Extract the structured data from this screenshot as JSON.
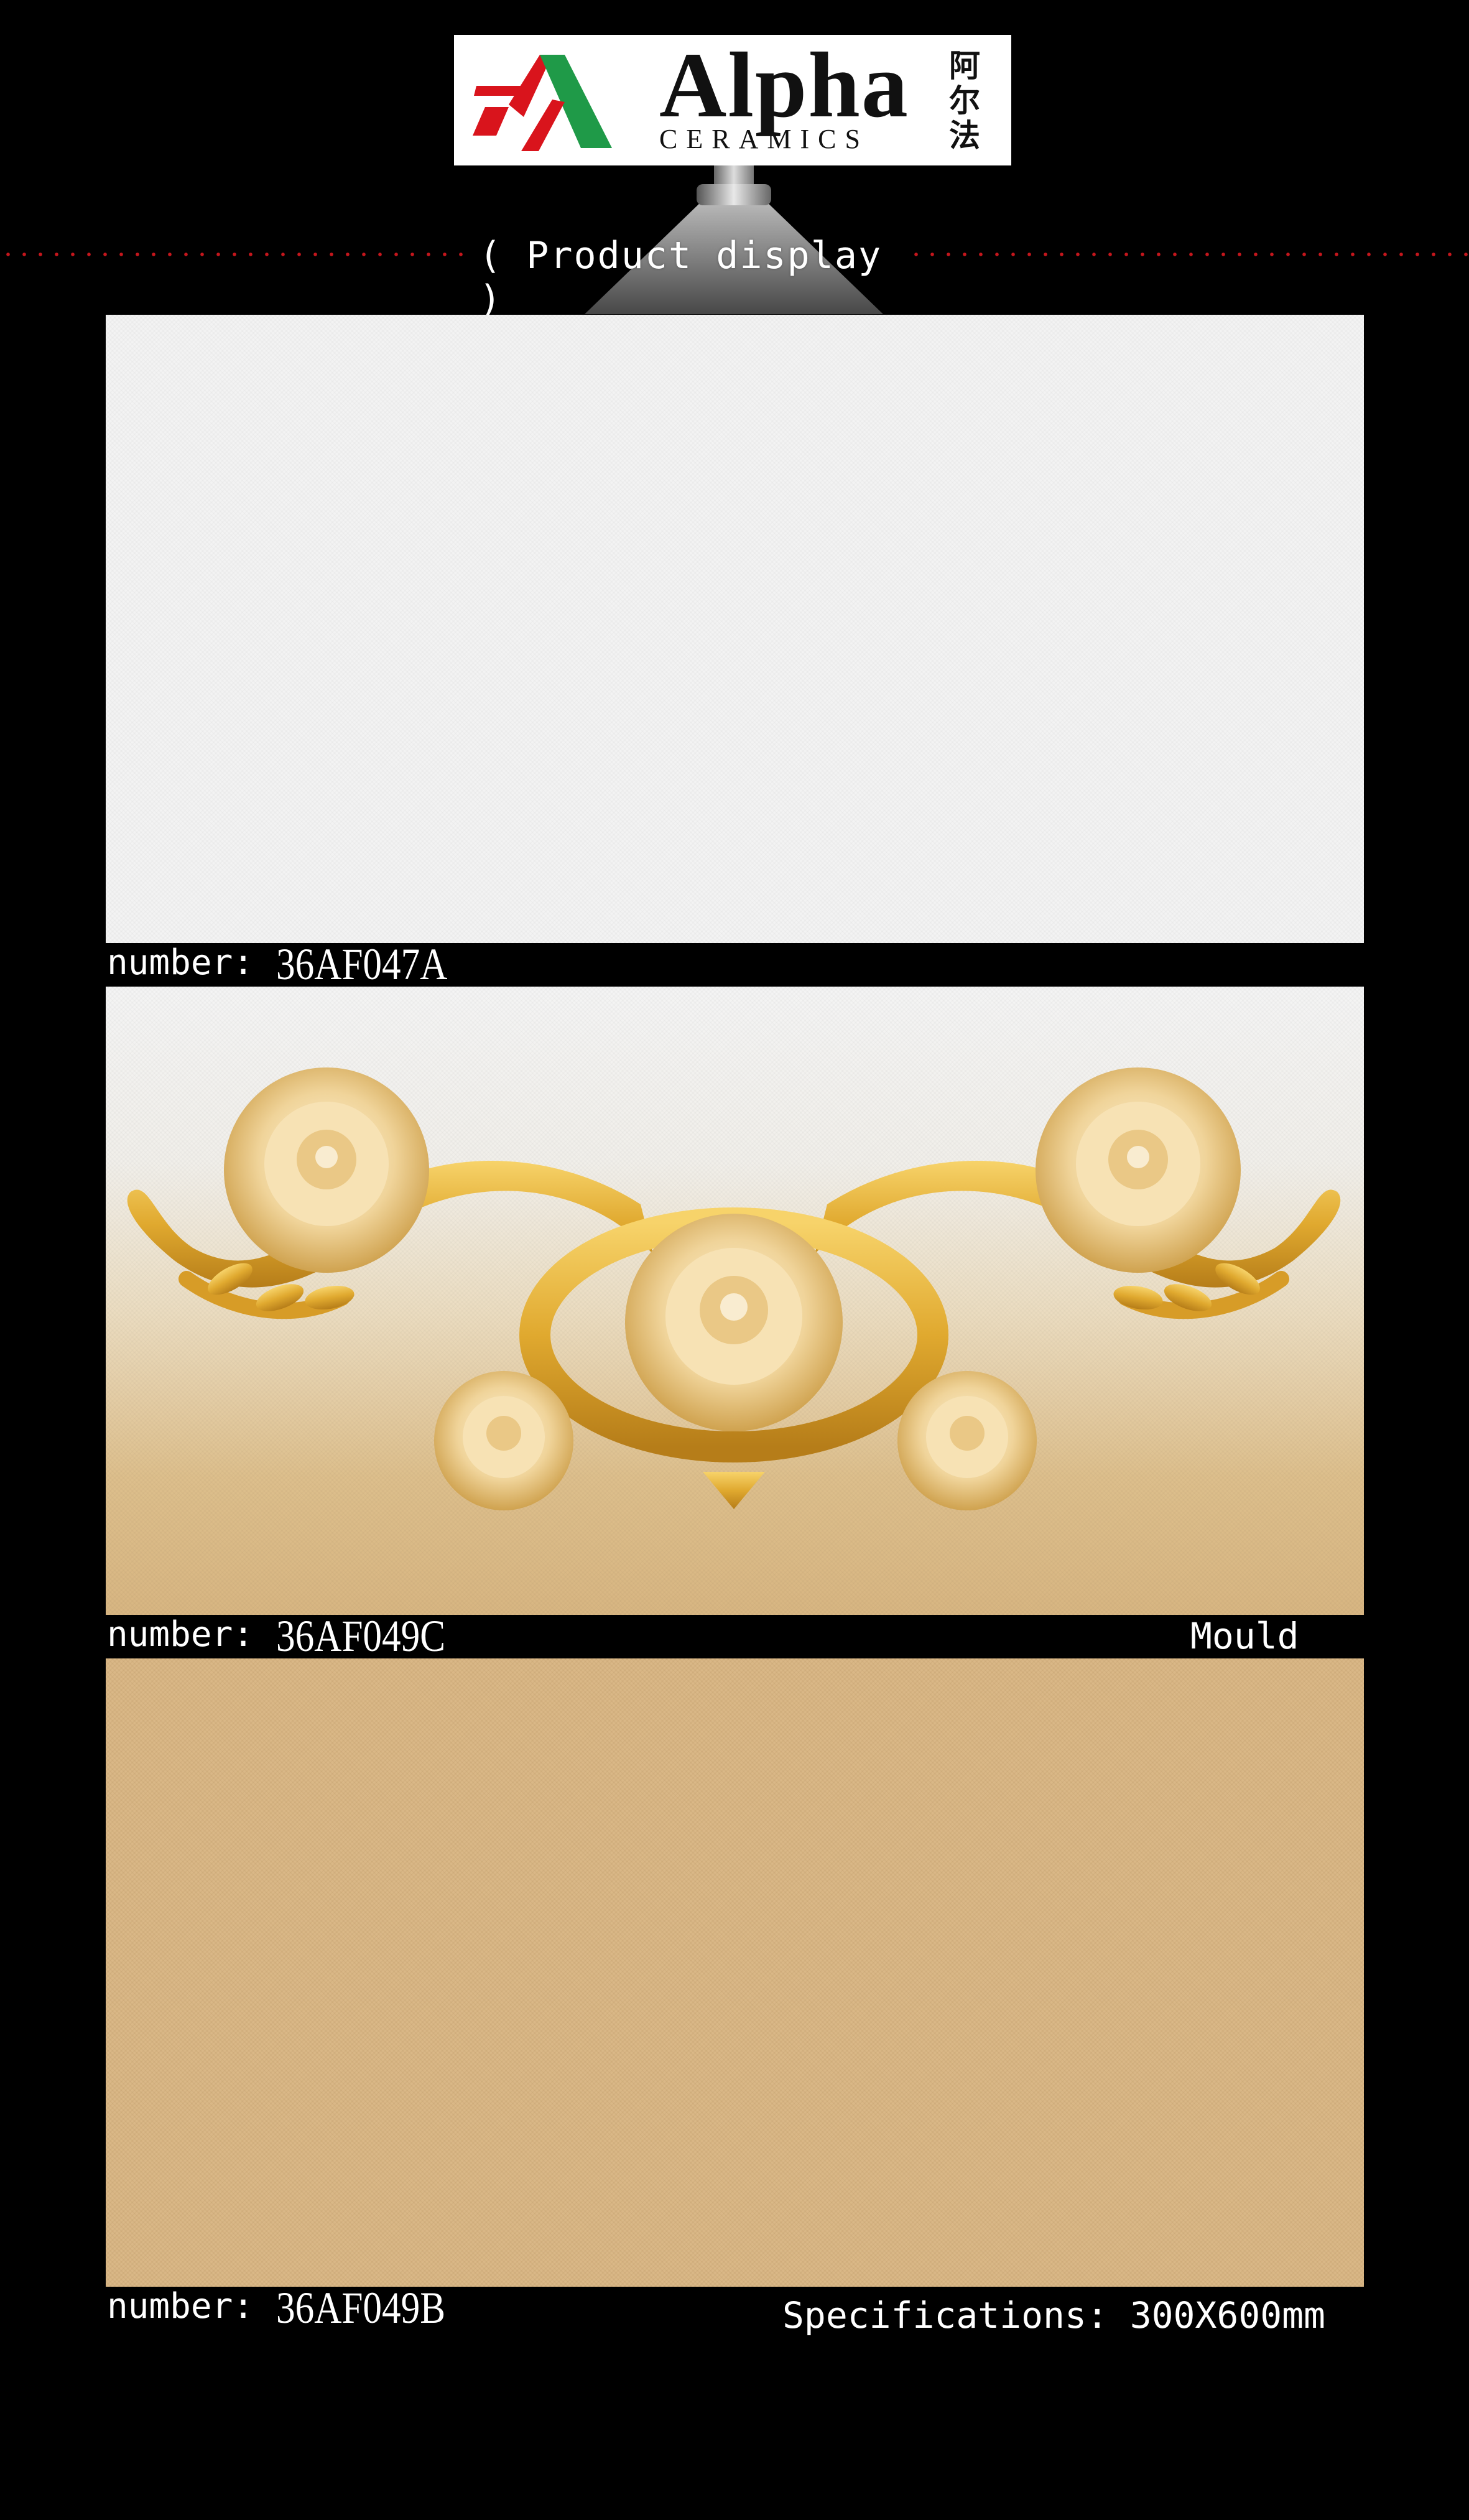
{
  "brand": {
    "name": "Alpha",
    "subtitle": "CERAMICS",
    "chinese_name": "阿尔法",
    "colors": {
      "red": "#d9141c",
      "green": "#1f9a48"
    }
  },
  "section_title": "( Product display )",
  "products": [
    {
      "number_label": "number:",
      "number": "36AF047A",
      "side_text": ""
    },
    {
      "number_label": "number:",
      "number": "36AF049C",
      "side_text": "Mould"
    },
    {
      "number_label": "number:",
      "number": "36AF049B",
      "side_text": "Specifications: 300X600mm"
    }
  ],
  "icons": {
    "logo": "alpha-logo-icon",
    "lamp": "spotlight-icon",
    "ornament": "golden-rose-ornament"
  }
}
